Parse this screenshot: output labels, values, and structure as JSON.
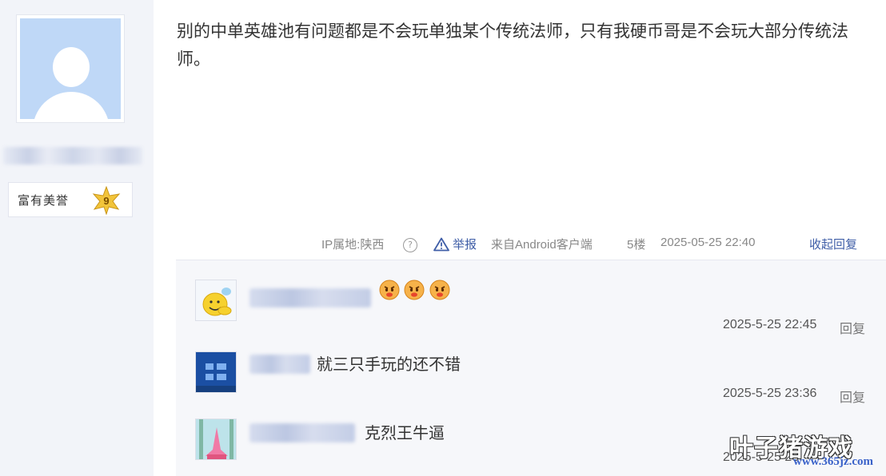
{
  "user": {
    "badge_label": "富有美誉",
    "badge_level": "9"
  },
  "post": {
    "text": "别的中单英雄池有问题都是不会玩单独某个传统法师，只有我硬币哥是不会玩大部分传统法师。"
  },
  "meta": {
    "ip_location": "IP属地:陕西",
    "help_icon": "?",
    "report_label": "举报",
    "client": "来自Android客户端",
    "floor": "5楼",
    "time": "2025-05-25 22:40",
    "collapse_label": "收起回复"
  },
  "replies": [
    {
      "text": "",
      "time": "2025-5-25 22:45",
      "reply_label": "回复",
      "emojis": [
        "angry-face-icon",
        "angry-face-icon",
        "angry-face-icon"
      ]
    },
    {
      "text": "就三只手玩的还不错",
      "time": "2025-5-25 23:36",
      "reply_label": "回复"
    },
    {
      "text": "克烈王牛逼",
      "time": "2025-5-25 23:",
      "reply_label": ""
    }
  ],
  "watermark": {
    "title": "叶子猪游戏",
    "url": "www.365jz.com"
  },
  "colors": {
    "link": "#3f5ea7",
    "sidebar_bg": "#f2f4f9",
    "reply_panel_bg": "#f6f7fa",
    "avatar_bg": "#bfd8f7",
    "badge_star": "#f2c43a"
  }
}
